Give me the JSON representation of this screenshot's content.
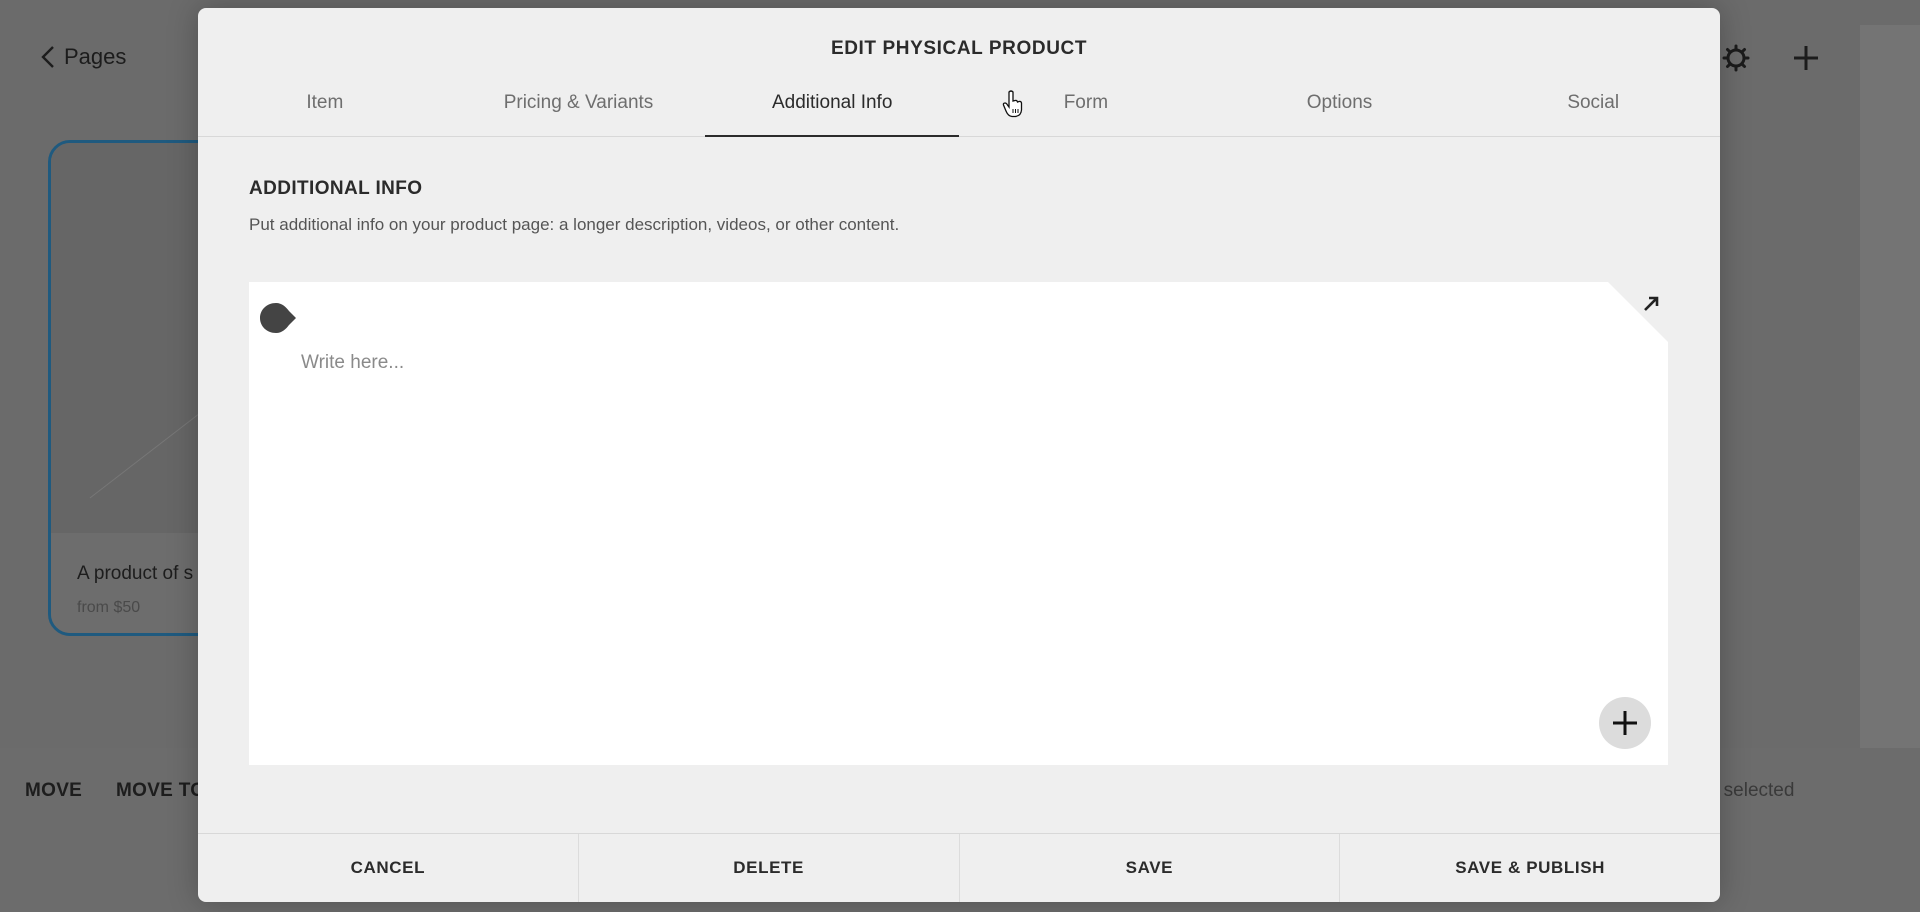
{
  "background": {
    "back_link": "Pages",
    "top_icons": [
      "gear-icon",
      "plus-icon"
    ],
    "product_card": {
      "title": "A product of s",
      "price": "from $50"
    },
    "bottom_actions": [
      "MOVE",
      "MOVE TO"
    ],
    "selection_status": "em selected"
  },
  "modal": {
    "title": "EDIT PHYSICAL PRODUCT",
    "tabs": [
      {
        "label": "Item",
        "active": false
      },
      {
        "label": "Pricing & Variants",
        "active": false
      },
      {
        "label": "Additional Info",
        "active": true
      },
      {
        "label": "Form",
        "active": false
      },
      {
        "label": "Options",
        "active": false
      },
      {
        "label": "Social",
        "active": false
      }
    ],
    "section": {
      "heading": "ADDITIONAL INFO",
      "description": "Put additional info on your product page: a longer description, videos, or other content."
    },
    "editor": {
      "placeholder": "Write here...",
      "icons": [
        "drag-handle-icon",
        "expand-icon",
        "add-block-icon"
      ]
    },
    "footer": {
      "cancel": "CANCEL",
      "delete": "DELETE",
      "save": "SAVE",
      "save_publish": "SAVE & PUBLISH"
    }
  },
  "colors": {
    "overlay_bg": "#6b6b6b",
    "modal_bg": "#efefef",
    "card_border": "#1f5a7f",
    "text_primary": "#2b2b2b"
  }
}
